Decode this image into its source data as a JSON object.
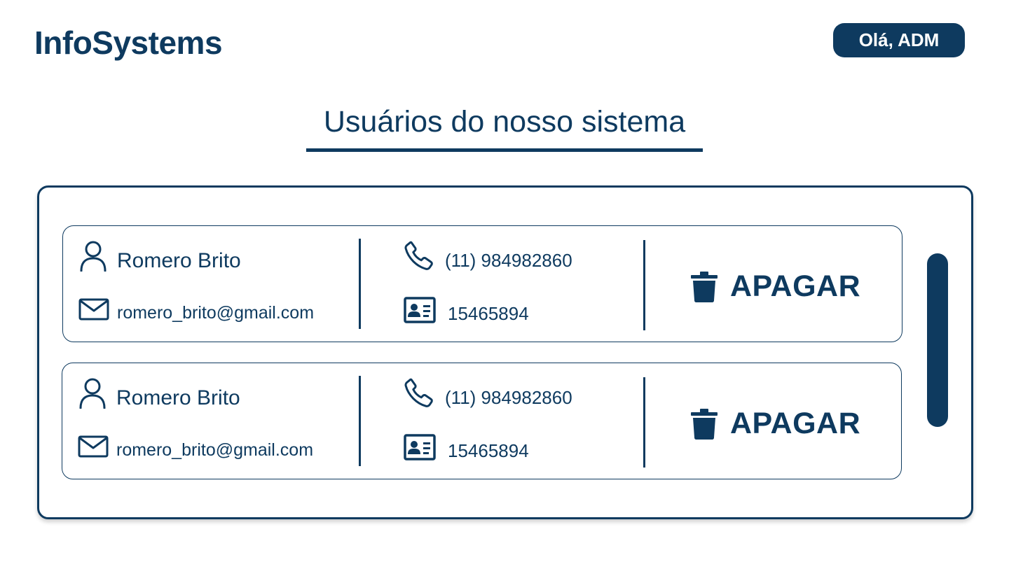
{
  "header": {
    "brand": "InfoSystems",
    "greeting": "Olá, ADM"
  },
  "page": {
    "title": "Usuários do nosso sistema"
  },
  "users": [
    {
      "name": "Romero Brito",
      "email": "romero_brito@gmail.com",
      "phone": "(11) 984982860",
      "document": "15465894",
      "delete_label": "APAGAR"
    },
    {
      "name": "Romero Brito",
      "email": "romero_brito@gmail.com",
      "phone": "(11) 984982860",
      "document": "15465894",
      "delete_label": "APAGAR"
    }
  ],
  "icons": {
    "user": "user-icon",
    "mail": "mail-icon",
    "phone": "phone-icon",
    "id_card": "id-card-icon",
    "trash": "trash-icon"
  },
  "colors": {
    "primary": "#0e3a5f",
    "background": "#ffffff"
  }
}
